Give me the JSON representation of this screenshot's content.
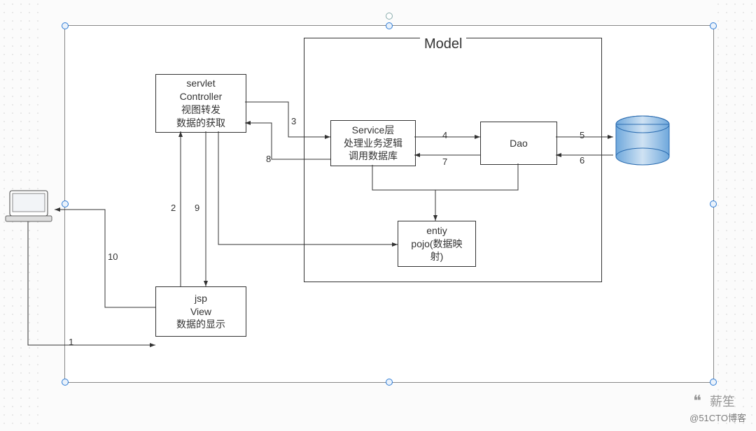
{
  "title": "Model",
  "boxes": {
    "controller": {
      "l1": "servlet",
      "l2": "Controller",
      "l3": "视图转发",
      "l4": "数据的获取"
    },
    "service": {
      "l1": "Service层",
      "l2": "处理业务逻辑",
      "l3": "调用数据库"
    },
    "dao": {
      "l1": "Dao"
    },
    "entity": {
      "l1": "entiy",
      "l2": "pojo(数据映",
      "l3": "射)"
    },
    "view": {
      "l1": "jsp",
      "l2": "View",
      "l3": "数据的显示"
    }
  },
  "edges": {
    "1": "1",
    "2": "2",
    "3": "3",
    "4": "4",
    "5": "5",
    "6": "6",
    "7": "7",
    "8": "8",
    "9": "9",
    "10": "10"
  },
  "watermark": {
    "logo": "❝",
    "name": "薪笙",
    "site": "@51CTO博客"
  }
}
